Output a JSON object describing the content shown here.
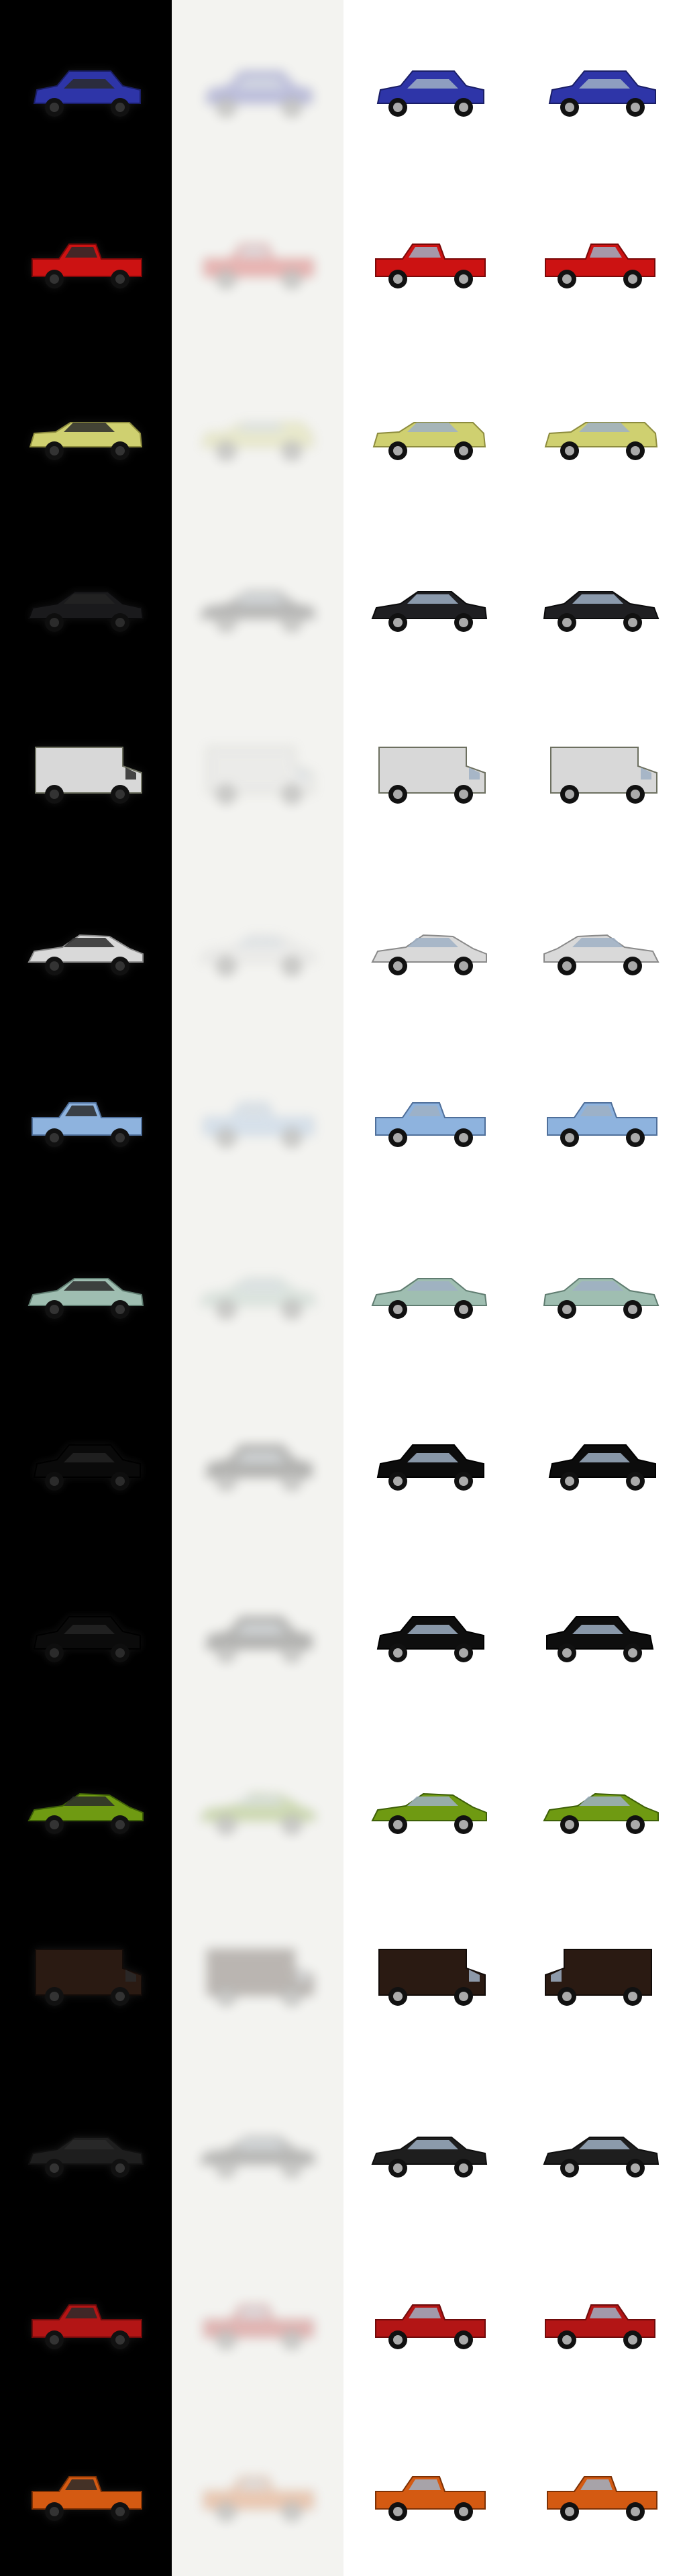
{
  "columns": [
    {
      "name": "column-dark-render",
      "bg": "#000000",
      "mode": "dark"
    },
    {
      "name": "column-blurred-render",
      "bg": "#f3f3f0",
      "mode": "fog"
    },
    {
      "name": "column-side-view",
      "bg": "#ffffff",
      "mode": "side"
    },
    {
      "name": "column-alt-view",
      "bg": "#ffffff",
      "mode": "alt"
    }
  ],
  "rows": [
    {
      "id": "blue-hatchback",
      "body": "#2e35a8",
      "dark": "#1a1e66",
      "kind": "hatch"
    },
    {
      "id": "red-pickup",
      "body": "#cc1212",
      "dark": "#7a0808",
      "kind": "pickup"
    },
    {
      "id": "yellow-wagon",
      "body": "#cfd070",
      "dark": "#8d8c3e",
      "kind": "wagon"
    },
    {
      "id": "black-sedan",
      "body": "#1f1f22",
      "dark": "#0b0b0c",
      "kind": "sedan"
    },
    {
      "id": "white-utility-truck",
      "body": "#d8d8d8",
      "dark": "#6d7060",
      "kind": "truck"
    },
    {
      "id": "silver-coupe",
      "body": "#d9d9d9",
      "dark": "#8a8a8a",
      "kind": "coupe"
    },
    {
      "id": "light-blue-pickup",
      "body": "#8eb3de",
      "dark": "#4f6f9a",
      "kind": "pickup"
    },
    {
      "id": "green-muscle-car",
      "body": "#9fbeb1",
      "dark": "#5f7c70",
      "kind": "sedan"
    },
    {
      "id": "black-hatchback",
      "body": "#0c0c0c",
      "dark": "#000000",
      "kind": "hatch"
    },
    {
      "id": "black-hatchback-rear",
      "body": "#0e0e0e",
      "dark": "#000000",
      "kind": "hatch"
    },
    {
      "id": "green-sports-car",
      "body": "#6f9a12",
      "dark": "#3d5f07",
      "kind": "coupe"
    },
    {
      "id": "brown-delivery-van",
      "body": "#2a1a12",
      "dark": "#120b08",
      "kind": "van"
    },
    {
      "id": "black-police-car",
      "body": "#1e1e1e",
      "dark": "#0f0f0f",
      "kind": "sedan"
    },
    {
      "id": "red-monster-pickup",
      "body": "#b31515",
      "dark": "#6f0b0b",
      "kind": "pickup"
    },
    {
      "id": "orange-pickup",
      "body": "#d45a12",
      "dark": "#7d3105",
      "kind": "pickup"
    }
  ]
}
